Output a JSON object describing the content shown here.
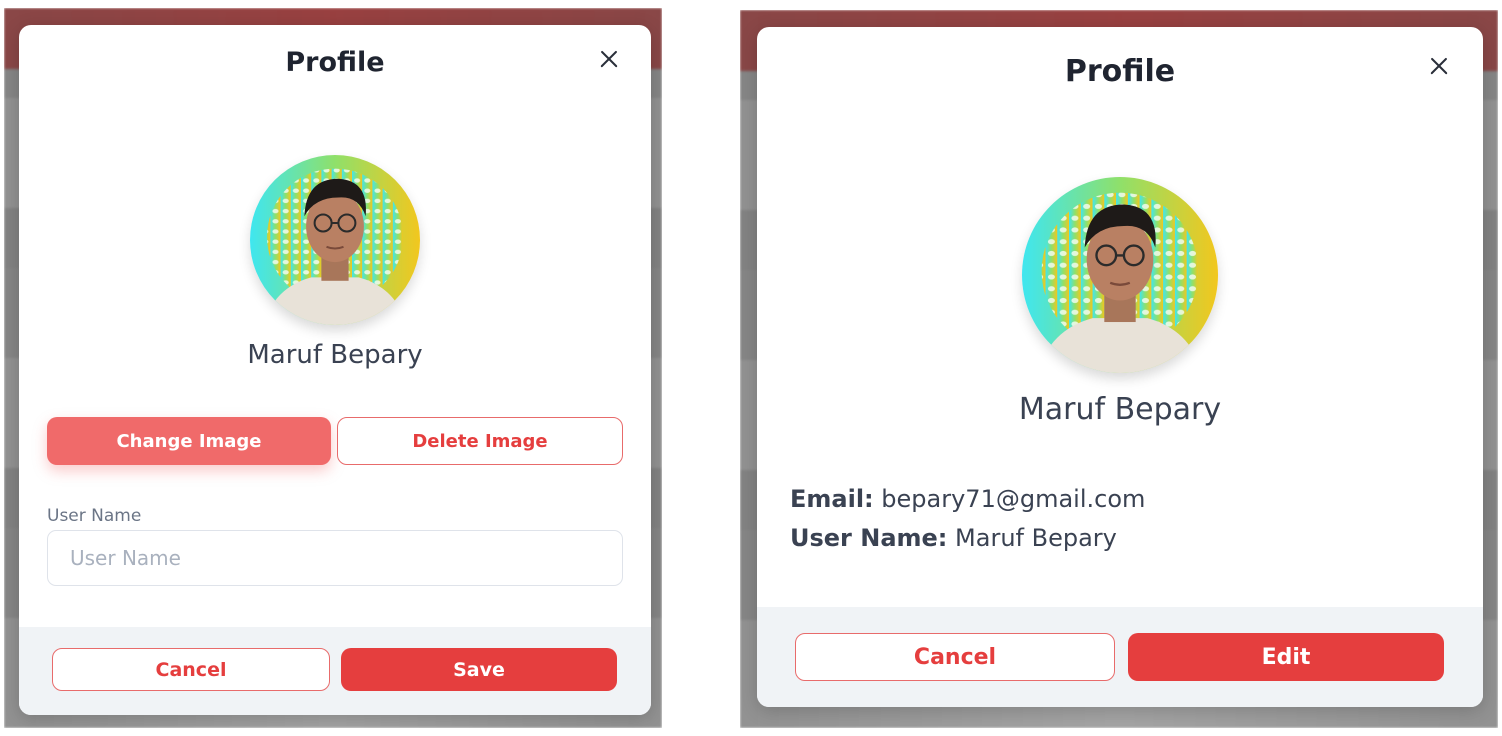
{
  "colors": {
    "accent": "#e53e3e",
    "accent_light": "#f06a6a",
    "text_dark": "#1f2430",
    "text_body": "#3a4252",
    "footer_bg": "#f0f3f6"
  },
  "edit_modal": {
    "title": "Profile",
    "close_icon": "close-icon",
    "user_name": "Maruf Bepary",
    "change_image_label": "Change Image",
    "delete_image_label": "Delete Image",
    "field_label": "User Name",
    "field_placeholder": "User Name",
    "field_value": "",
    "cancel_label": "Cancel",
    "save_label": "Save"
  },
  "view_modal": {
    "title": "Profile",
    "close_icon": "close-icon",
    "user_name": "Maruf Bepary",
    "email_label": "Email:",
    "email_value": "bepary71@gmail.com",
    "username_label": "User Name:",
    "username_value": "Maruf Bepary",
    "cancel_label": "Cancel",
    "edit_label": "Edit"
  }
}
